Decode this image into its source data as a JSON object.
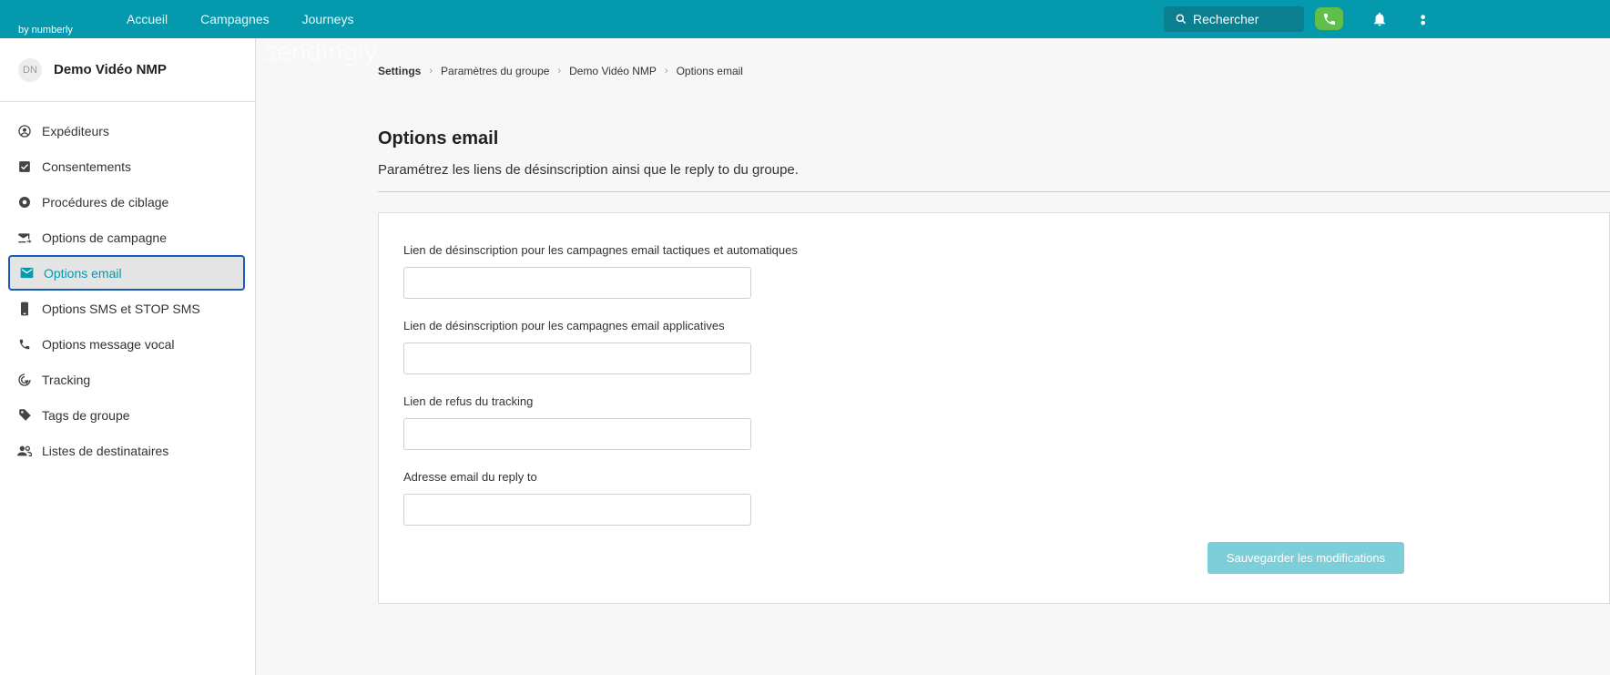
{
  "topbar": {
    "logo": {
      "main": "sendingly",
      "sub": "by numberly"
    },
    "nav": [
      "Accueil",
      "Campagnes",
      "Journeys"
    ],
    "search_placeholder": "Rechercher",
    "icons": [
      "search-icon",
      "phone-icon",
      "bell-icon"
    ],
    "accent": "#0499ad"
  },
  "sidebar": {
    "avatar": "DN",
    "group_name": "Demo Vidéo NMP",
    "items": [
      {
        "label": "Expéditeurs",
        "icon": "user-circle-icon"
      },
      {
        "label": "Consentements",
        "icon": "checkbox-icon"
      },
      {
        "label": "Procédures de ciblage",
        "icon": "target-icon"
      },
      {
        "label": "Options de campagne",
        "icon": "mail-send-icon"
      },
      {
        "label": "Options email",
        "icon": "mail-icon",
        "active": true
      },
      {
        "label": "Options SMS et STOP SMS",
        "icon": "mobile-icon"
      },
      {
        "label": "Options message vocal",
        "icon": "phone-icon"
      },
      {
        "label": "Tracking",
        "icon": "tracking-icon"
      },
      {
        "label": "Tags de groupe",
        "icon": "tag-icon"
      },
      {
        "label": "Listes de destinataires",
        "icon": "people-icon"
      }
    ]
  },
  "breadcrumb": [
    "Settings",
    "Paramètres du groupe",
    "Demo Vidéo NMP",
    "Options email"
  ],
  "page": {
    "title": "Options email",
    "description": "Paramétrez les liens de désinscription ainsi que le reply to du groupe."
  },
  "form": {
    "fields": [
      {
        "label": "Lien de désinscription pour les campagnes email tactiques et automatiques",
        "value": ""
      },
      {
        "label": "Lien de désinscription pour les campagnes email applicatives",
        "value": ""
      },
      {
        "label": "Lien de refus du tracking",
        "value": ""
      },
      {
        "label": "Adresse email du reply to",
        "value": ""
      }
    ],
    "save_label": "Sauvegarder les modifications"
  }
}
